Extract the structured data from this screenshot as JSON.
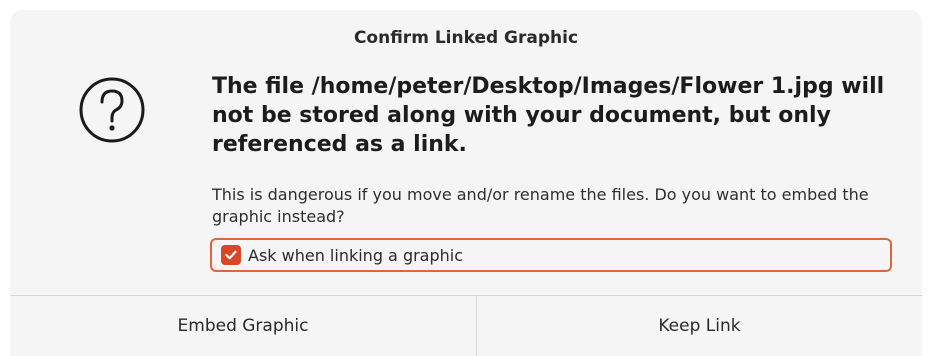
{
  "dialog": {
    "title": "Confirm Linked Graphic",
    "icon": "question-circle-icon",
    "headline": "The file /home/peter/Desktop/Images/Flower 1.jpg will not be stored along with your document, but only referenced as a link.",
    "body": "This is dangerous if you move and/or rename the files. Do you want to embed the graphic instead?",
    "checkbox": {
      "label": "Ask when linking a graphic",
      "checked": true
    },
    "buttons": {
      "embed_label": "Embed Graphic",
      "keep_label": "Keep Link"
    }
  },
  "colors": {
    "accent": "#d9472b",
    "focus_border": "#e0643f",
    "dialog_bg": "#f5f5f5"
  }
}
